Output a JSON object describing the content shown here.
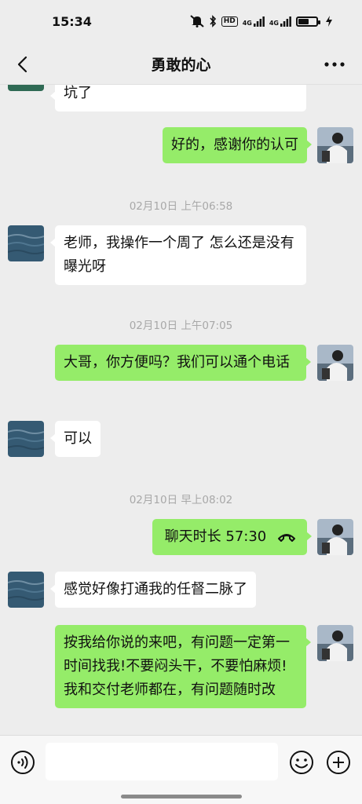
{
  "status_bar": {
    "time": "15:34",
    "hd_label": "HD",
    "net1": "4G",
    "net2": "4G"
  },
  "header": {
    "title": "勇敢的心"
  },
  "messages": [
    {
      "side": "in",
      "text": "坑了"
    },
    {
      "side": "out",
      "text": "好的，感谢你的认可"
    },
    {
      "type": "time",
      "text": "02月10日 上午06:58"
    },
    {
      "side": "in",
      "text": "老师，我操作一个周了 怎么还是没有曝光呀"
    },
    {
      "type": "time",
      "text": "02月10日 上午07:05"
    },
    {
      "side": "out",
      "text": "大哥，你方便吗？我们可以通个电话"
    },
    {
      "side": "in",
      "text": "可以"
    },
    {
      "type": "time",
      "text": "02月10日 早上08:02"
    },
    {
      "side": "out",
      "type": "call",
      "text": "聊天时长  57:30"
    },
    {
      "side": "in",
      "text": "感觉好像打通我的任督二脉了"
    },
    {
      "side": "out",
      "text": "按我给你说的来吧，有问题一定第一时间找我!不要闷头干，不要怕麻烦!我和交付老师都在，有问题随时改"
    }
  ],
  "input": {
    "value": ""
  },
  "colors": {
    "outgoing_bubble": "#95ec69",
    "incoming_bubble": "#ffffff",
    "background": "#ededed"
  }
}
